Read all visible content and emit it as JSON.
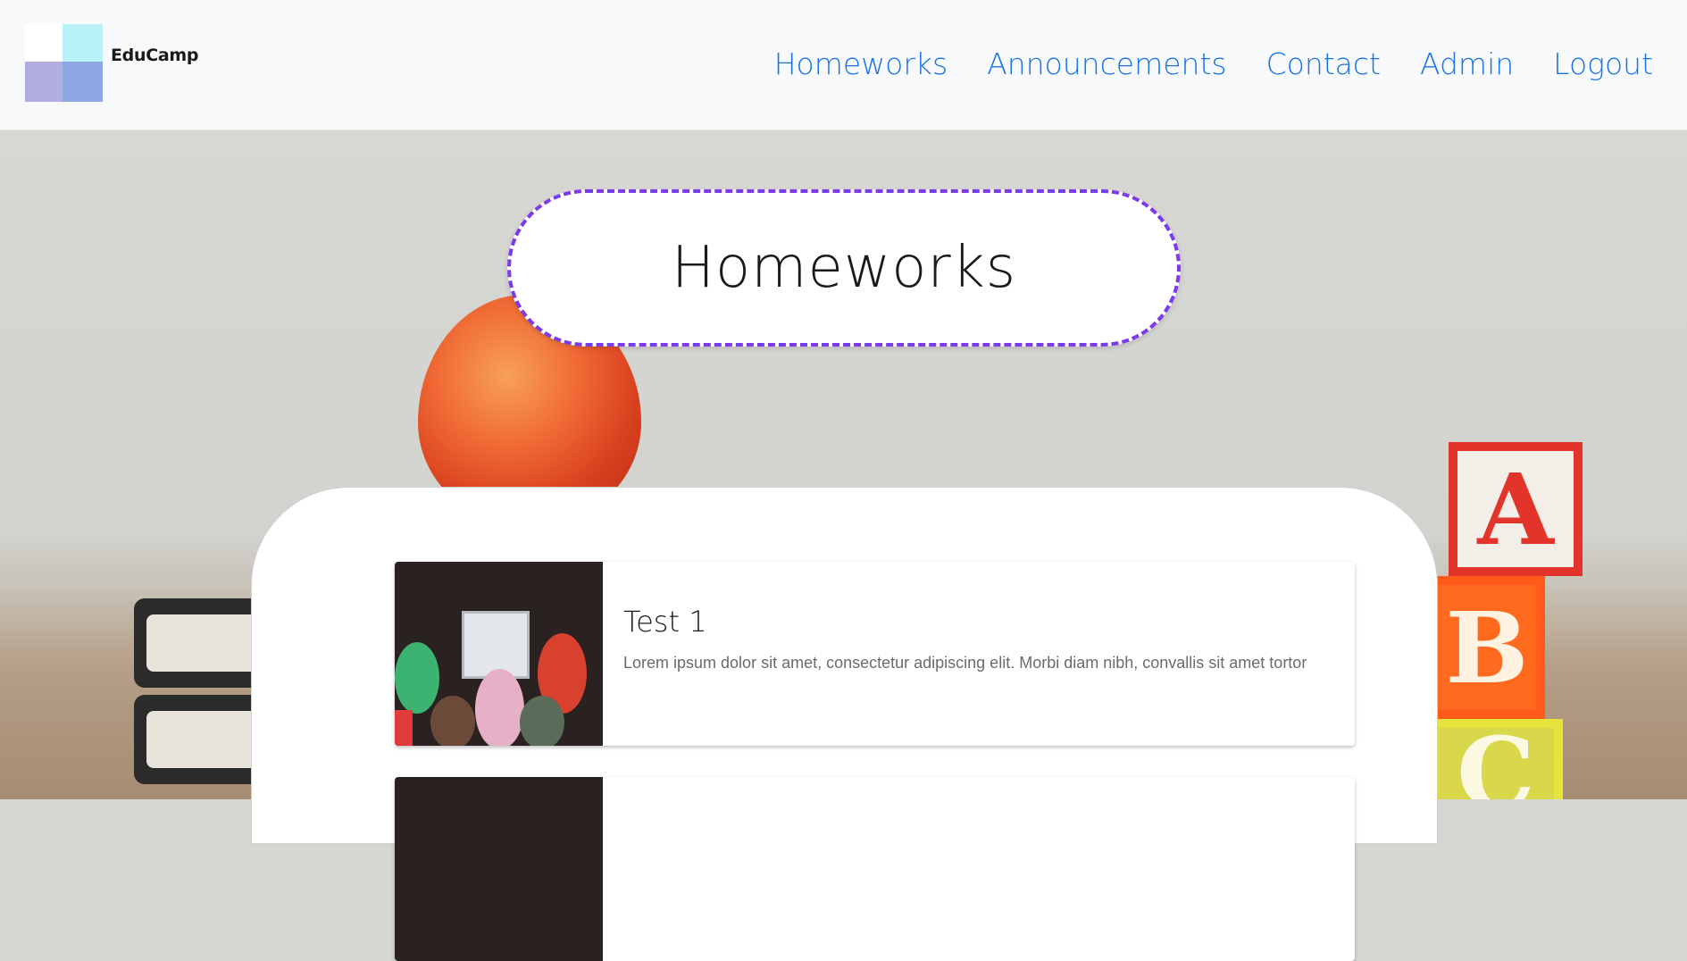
{
  "brand": {
    "name": "EduCamp"
  },
  "nav": {
    "items": [
      {
        "label": "Homeworks"
      },
      {
        "label": "Announcements"
      },
      {
        "label": "Contact"
      },
      {
        "label": "Admin"
      },
      {
        "label": "Logout"
      }
    ]
  },
  "hero": {
    "title": "Homeworks",
    "blocks": [
      "A",
      "B",
      "C"
    ]
  },
  "homeworks": [
    {
      "title": "Test 1",
      "description": "Lorem ipsum dolor sit amet, consectetur adipiscing elit. Morbi diam nibh, convallis sit amet tortor"
    },
    {
      "title": "",
      "description": ""
    }
  ],
  "colors": {
    "nav_link": "#1a73e8",
    "title_border": "#7c3aed",
    "header_bg": "#f8f9fa"
  }
}
